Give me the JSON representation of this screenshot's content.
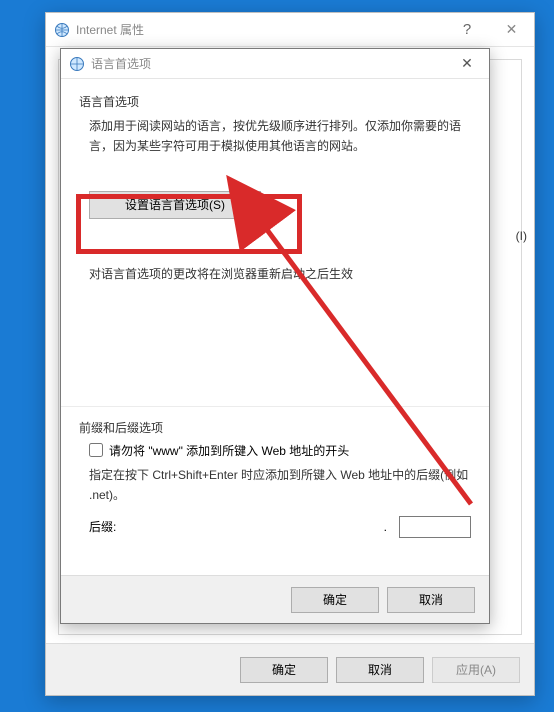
{
  "parent": {
    "title": "Internet 属性",
    "footer": {
      "ok": "确定",
      "cancel": "取消",
      "apply": "应用(A)"
    }
  },
  "child": {
    "title": "语言首选项",
    "section1_title": "语言首选项",
    "section1_desc": "添加用于阅读网站的语言，按优先级顺序进行排列。仅添加你需要的语言，因为某些字符可用于模拟使用其他语言的网站。",
    "set_lang_button": "设置语言首选项(S)",
    "note": "对语言首选项的更改将在浏览器重新启动之后生效",
    "section2_title": "前缀和后缀选项",
    "checkbox_label": "请勿将 \"www\" 添加到所键入 Web 地址的开头",
    "suffix_desc": "指定在按下 Ctrl+Shift+Enter 时应添加到所键入 Web 地址中的后缀(例如 .net)。",
    "suffix_label": "后缀:",
    "suffix_value": "",
    "footer": {
      "ok": "确定",
      "cancel": "取消"
    }
  },
  "annotation": {
    "side_text": "(I)"
  }
}
